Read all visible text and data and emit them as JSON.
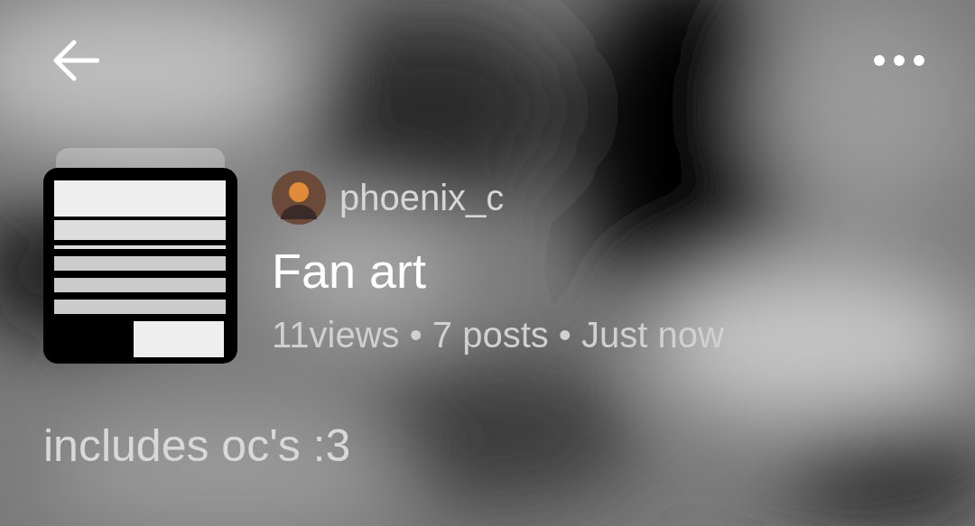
{
  "collection": {
    "author": "phoenix_c",
    "title": "Fan art",
    "meta": "11views • 7 posts • Just now",
    "description": "includes oc's :3"
  }
}
